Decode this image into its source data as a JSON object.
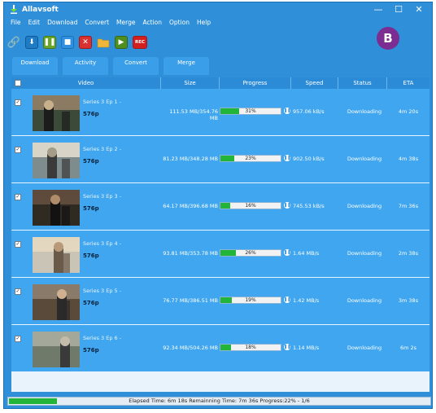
{
  "app": {
    "title": "Allavsoft",
    "badge": "B",
    "menu": [
      "File",
      "Edit",
      "Download",
      "Convert",
      "Merge",
      "Action",
      "Option",
      "Help"
    ],
    "window_controls": {
      "minimize": "—",
      "maximize": "☐",
      "close": "✕"
    }
  },
  "toolbar": {
    "buttons": [
      "link-icon",
      "download-icon",
      "pause-icon",
      "stop-icon",
      "delete-icon",
      "folder-icon",
      "play-icon",
      "record-icon"
    ],
    "rec_label": "REC"
  },
  "tabs": [
    "Download",
    "Activity",
    "Convert",
    "Merge"
  ],
  "table": {
    "headers": [
      "Video",
      "Size",
      "Progress",
      "Speed",
      "Status",
      "ETA"
    ],
    "rows": [
      {
        "checked": "✓",
        "name": "Series 3 Ep 1 -",
        "resolution": "576p",
        "size": "111.53 MB/354.76 MB",
        "progress": 31,
        "progress_label": "31%",
        "speed": "957.06 kB/s",
        "status": "Downloading",
        "eta": "4m 20s"
      },
      {
        "checked": "✓",
        "name": "Series 3 Ep 2 -",
        "resolution": "576p",
        "size": "81.23 MB/348.28 MB",
        "progress": 23,
        "progress_label": "23%",
        "speed": "902.50 kB/s",
        "status": "Downloading",
        "eta": "4m 38s"
      },
      {
        "checked": "✓",
        "name": "Series 3 Ep 3 -",
        "resolution": "576p",
        "size": "64.17 MB/396.68 MB",
        "progress": 16,
        "progress_label": "16%",
        "speed": "745.53 kB/s",
        "status": "Downloading",
        "eta": "7m 36s"
      },
      {
        "checked": "✓",
        "name": "Series 3 Ep 4 -",
        "resolution": "576p",
        "size": "93.81 MB/353.78 MB",
        "progress": 26,
        "progress_label": "26%",
        "speed": "1.64 MB/s",
        "status": "Downloading",
        "eta": "2m 38s"
      },
      {
        "checked": "✓",
        "name": "Series 3 Ep 5 -",
        "resolution": "576p",
        "size": "76.77 MB/386.51 MB",
        "progress": 19,
        "progress_label": "19%",
        "speed": "1.42 MB/s",
        "status": "Downloading",
        "eta": "3m 38s"
      },
      {
        "checked": "✓",
        "name": "Series 3 Ep 6 -",
        "resolution": "576p",
        "size": "92.34 MB/504.26 MB",
        "progress": 18,
        "progress_label": "18%",
        "speed": "1.14 MB/s",
        "status": "Downloading",
        "eta": "6m  2s"
      }
    ]
  },
  "statusbar": {
    "text": "Elapsed Time: 6m 18s Remainning Time: 7m 36s Progress:22% - 1/6",
    "progress": 22
  }
}
